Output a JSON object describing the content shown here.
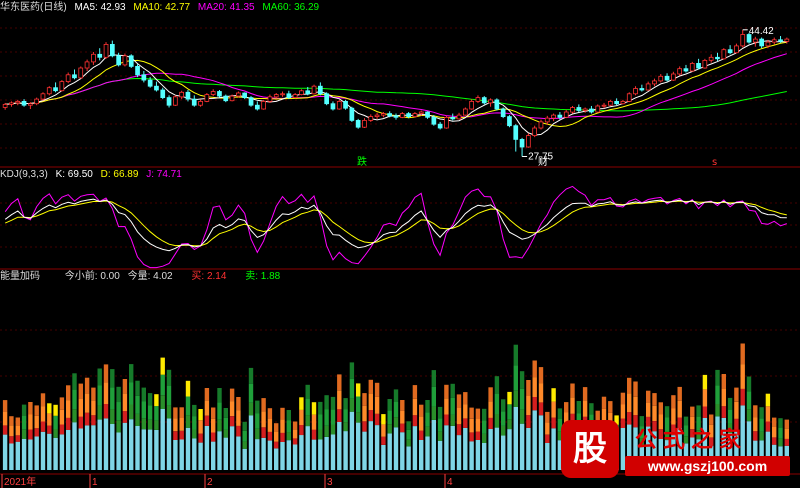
{
  "colors": {
    "up": "#ff3232",
    "down": "#54ffff",
    "ma5": "#ffffff",
    "ma10": "#ffff00",
    "ma20": "#ff00ff",
    "ma60": "#00ff00",
    "k": "#ffffff",
    "d": "#ffff00",
    "j": "#ff00ff",
    "grid": "#8b0000",
    "panel_border": "#8b0000"
  },
  "main_panel": {
    "stock_name": "华东医药(日线)",
    "ma5_label": "MA5: 42.93",
    "ma10_label": "MA10: 42.77",
    "ma20_label": "MA20: 41.35",
    "ma60_label": "MA60: 36.29",
    "high_label": "44.42",
    "low_label": "27.75",
    "mark_die": "跌",
    "mark_cai": "财",
    "mark_s": "s"
  },
  "kdj_panel": {
    "title": "KDJ(9,3,3)",
    "k_label": "K: 69.50",
    "d_label": "D: 66.89",
    "j_label": "J: 74.71"
  },
  "vol_panel": {
    "title": "能量加码",
    "jxq_label": "今小前: 0.00",
    "jl_label": "今量: 4.02",
    "buy_label": "买: 2.14",
    "sell_label": "卖: 1.88"
  },
  "x_axis": {
    "labels": [
      "2021年",
      "1",
      "2",
      "3",
      "4"
    ]
  },
  "watermark": {
    "badge": "股",
    "title": "公式之家",
    "url": "www.gszj100.com"
  },
  "chart_data": [
    {
      "type": "candlestick",
      "title": "华东医药(日线)",
      "ylim": [
        26.5,
        46.5
      ],
      "ohlc": [
        [
          34.2,
          34.8,
          33.9,
          34.6
        ],
        [
          34.6,
          35.0,
          34.3,
          34.8
        ],
        [
          34.8,
          35.2,
          34.5,
          35.0
        ],
        [
          35.0,
          35.3,
          34.3,
          34.5
        ],
        [
          34.5,
          34.9,
          34.0,
          34.7
        ],
        [
          34.7,
          35.5,
          34.5,
          35.3
        ],
        [
          35.3,
          36.2,
          35.1,
          36.0
        ],
        [
          36.0,
          37.0,
          35.8,
          36.8
        ],
        [
          36.8,
          37.5,
          36.2,
          36.4
        ],
        [
          36.4,
          37.8,
          36.3,
          37.6
        ],
        [
          37.6,
          38.8,
          37.4,
          38.5
        ],
        [
          38.5,
          39.2,
          37.9,
          38.1
        ],
        [
          38.1,
          39.6,
          38.0,
          39.4
        ],
        [
          39.4,
          40.5,
          39.0,
          40.2
        ],
        [
          40.2,
          41.5,
          39.8,
          41.2
        ],
        [
          41.2,
          42.0,
          40.4,
          40.8
        ],
        [
          40.8,
          42.8,
          40.6,
          42.5
        ],
        [
          42.5,
          43.0,
          40.8,
          41.0
        ],
        [
          41.0,
          41.4,
          39.6,
          39.8
        ],
        [
          39.8,
          41.3,
          39.6,
          41.0
        ],
        [
          41.0,
          41.2,
          39.4,
          39.6
        ],
        [
          39.6,
          39.9,
          38.2,
          38.5
        ],
        [
          38.5,
          39.0,
          37.5,
          37.8
        ],
        [
          37.8,
          38.2,
          36.8,
          37.0
        ],
        [
          37.0,
          37.6,
          36.3,
          36.5
        ],
        [
          36.5,
          36.8,
          35.3,
          35.5
        ],
        [
          35.5,
          35.8,
          34.2,
          34.5
        ],
        [
          34.5,
          35.8,
          34.4,
          35.6
        ],
        [
          35.6,
          36.4,
          35.3,
          36.2
        ],
        [
          36.2,
          36.5,
          35.0,
          35.3
        ],
        [
          35.3,
          35.8,
          34.3,
          34.5
        ],
        [
          34.5,
          35.2,
          34.3,
          35.0
        ],
        [
          35.0,
          36.1,
          34.9,
          35.9
        ],
        [
          35.9,
          36.6,
          35.7,
          36.3
        ],
        [
          36.3,
          36.5,
          35.5,
          35.7
        ],
        [
          35.7,
          35.9,
          34.9,
          35.1
        ],
        [
          35.1,
          35.9,
          35.0,
          35.7
        ],
        [
          35.7,
          36.3,
          35.5,
          36.1
        ],
        [
          36.1,
          36.2,
          35.3,
          35.5
        ],
        [
          35.5,
          35.7,
          34.3,
          34.5
        ],
        [
          34.5,
          35.0,
          33.8,
          34.0
        ],
        [
          34.0,
          35.2,
          33.9,
          35.0
        ],
        [
          35.0,
          35.9,
          34.8,
          35.6
        ],
        [
          35.6,
          36.1,
          35.4,
          35.9
        ],
        [
          35.9,
          36.3,
          35.6,
          36.0
        ],
        [
          36.0,
          36.4,
          35.3,
          35.5
        ],
        [
          35.5,
          36.1,
          35.4,
          35.9
        ],
        [
          35.9,
          36.6,
          35.8,
          36.4
        ],
        [
          36.4,
          36.9,
          35.8,
          36.0
        ],
        [
          36.0,
          37.2,
          35.9,
          37.0
        ],
        [
          37.0,
          37.5,
          35.8,
          36.0
        ],
        [
          36.0,
          36.2,
          34.5,
          34.7
        ],
        [
          34.7,
          35.0,
          33.8,
          34.0
        ],
        [
          34.0,
          35.2,
          33.9,
          35.0
        ],
        [
          35.0,
          35.2,
          33.9,
          34.1
        ],
        [
          34.1,
          34.3,
          32.3,
          32.5
        ],
        [
          32.5,
          32.7,
          31.4,
          31.6
        ],
        [
          31.6,
          32.8,
          31.5,
          32.5
        ],
        [
          32.5,
          33.3,
          32.3,
          33.0
        ],
        [
          33.0,
          33.5,
          32.7,
          33.2
        ],
        [
          33.2,
          33.6,
          32.9,
          33.4
        ],
        [
          33.4,
          33.7,
          32.9,
          33.1
        ],
        [
          33.1,
          33.4,
          32.6,
          32.9
        ],
        [
          32.9,
          33.6,
          32.8,
          33.4
        ],
        [
          33.4,
          33.6,
          32.8,
          33.0
        ],
        [
          33.0,
          33.6,
          32.9,
          33.4
        ],
        [
          33.4,
          33.8,
          33.1,
          33.6
        ],
        [
          33.6,
          33.7,
          32.7,
          32.9
        ],
        [
          32.9,
          33.2,
          31.8,
          32.0
        ],
        [
          32.0,
          32.3,
          31.3,
          31.5
        ],
        [
          31.5,
          33.1,
          31.4,
          32.9
        ],
        [
          32.9,
          33.4,
          32.5,
          32.7
        ],
        [
          32.7,
          33.5,
          32.6,
          33.2
        ],
        [
          33.2,
          34.2,
          33.1,
          34.0
        ],
        [
          34.0,
          35.3,
          33.9,
          35.0
        ],
        [
          35.0,
          35.8,
          34.8,
          35.5
        ],
        [
          35.5,
          35.7,
          34.6,
          34.8
        ],
        [
          34.8,
          35.4,
          34.3,
          35.2
        ],
        [
          35.2,
          35.4,
          33.8,
          34.0
        ],
        [
          34.0,
          34.2,
          32.8,
          33.0
        ],
        [
          33.0,
          33.2,
          31.6,
          31.8
        ],
        [
          31.8,
          32.0,
          28.4,
          30.0
        ],
        [
          30.0,
          30.2,
          27.75,
          29.0
        ],
        [
          29.0,
          30.8,
          28.9,
          30.5
        ],
        [
          30.5,
          31.8,
          30.3,
          31.5
        ],
        [
          31.5,
          32.6,
          31.3,
          32.3
        ],
        [
          32.3,
          33.1,
          31.9,
          32.8
        ],
        [
          32.8,
          33.4,
          32.4,
          33.2
        ],
        [
          33.2,
          33.6,
          32.6,
          32.9
        ],
        [
          32.9,
          33.9,
          32.8,
          33.6
        ],
        [
          33.6,
          34.4,
          33.4,
          34.2
        ],
        [
          34.2,
          34.6,
          33.6,
          33.8
        ],
        [
          33.8,
          34.2,
          33.5,
          34.0
        ],
        [
          34.0,
          34.4,
          33.4,
          33.6
        ],
        [
          33.6,
          34.6,
          33.5,
          34.4
        ],
        [
          34.4,
          34.8,
          34.1,
          34.5
        ],
        [
          34.5,
          35.2,
          34.4,
          35.0
        ],
        [
          35.0,
          35.4,
          34.5,
          34.7
        ],
        [
          34.7,
          35.2,
          34.6,
          35.0
        ],
        [
          35.0,
          36.2,
          34.9,
          36.0
        ],
        [
          36.0,
          37.0,
          35.8,
          36.7
        ],
        [
          36.7,
          37.2,
          36.3,
          36.5
        ],
        [
          36.5,
          37.6,
          36.4,
          37.3
        ],
        [
          37.3,
          38.0,
          37.0,
          37.7
        ],
        [
          37.7,
          38.6,
          37.5,
          38.3
        ],
        [
          38.3,
          38.7,
          37.6,
          37.8
        ],
        [
          37.8,
          38.9,
          37.7,
          38.6
        ],
        [
          38.6,
          39.6,
          38.4,
          39.3
        ],
        [
          39.3,
          39.8,
          38.8,
          39.0
        ],
        [
          39.0,
          40.2,
          38.9,
          40.0
        ],
        [
          40.0,
          40.6,
          39.2,
          39.4
        ],
        [
          39.4,
          40.6,
          39.3,
          40.4
        ],
        [
          40.4,
          41.2,
          40.1,
          40.8
        ],
        [
          40.8,
          41.4,
          40.3,
          40.6
        ],
        [
          40.6,
          42.0,
          40.5,
          41.8
        ],
        [
          41.8,
          42.4,
          41.2,
          41.4
        ],
        [
          41.4,
          42.6,
          41.3,
          42.3
        ],
        [
          42.3,
          44.42,
          42.1,
          43.8
        ],
        [
          43.8,
          44.0,
          42.6,
          42.8
        ],
        [
          42.8,
          43.5,
          42.2,
          43.2
        ],
        [
          43.2,
          43.4,
          42.0,
          42.3
        ],
        [
          42.3,
          43.1,
          42.0,
          42.8
        ],
        [
          42.8,
          43.4,
          42.5,
          43.1
        ],
        [
          43.1,
          43.6,
          42.7,
          42.9
        ],
        [
          42.9,
          43.4,
          42.6,
          43.2
        ]
      ],
      "ma": [
        {
          "name": "MA5",
          "last": 42.93
        },
        {
          "name": "MA10",
          "last": 42.77
        },
        {
          "name": "MA20",
          "last": 41.35
        },
        {
          "name": "MA60",
          "last": 36.29
        }
      ],
      "annotations": [
        {
          "text": "44.42",
          "kind": "high"
        },
        {
          "text": "27.75",
          "kind": "low"
        }
      ]
    },
    {
      "type": "line",
      "title": "KDJ(9,3,3)",
      "ylim": [
        -20,
        120
      ],
      "series_last": {
        "K": 69.5,
        "D": 66.89,
        "J": 74.71
      }
    },
    {
      "type": "bar",
      "title": "能量加码",
      "ylim": [
        0,
        10
      ],
      "values_last": {
        "今小前": 0.0,
        "今量": 4.02,
        "买": 2.14,
        "卖": 1.88
      }
    }
  ]
}
